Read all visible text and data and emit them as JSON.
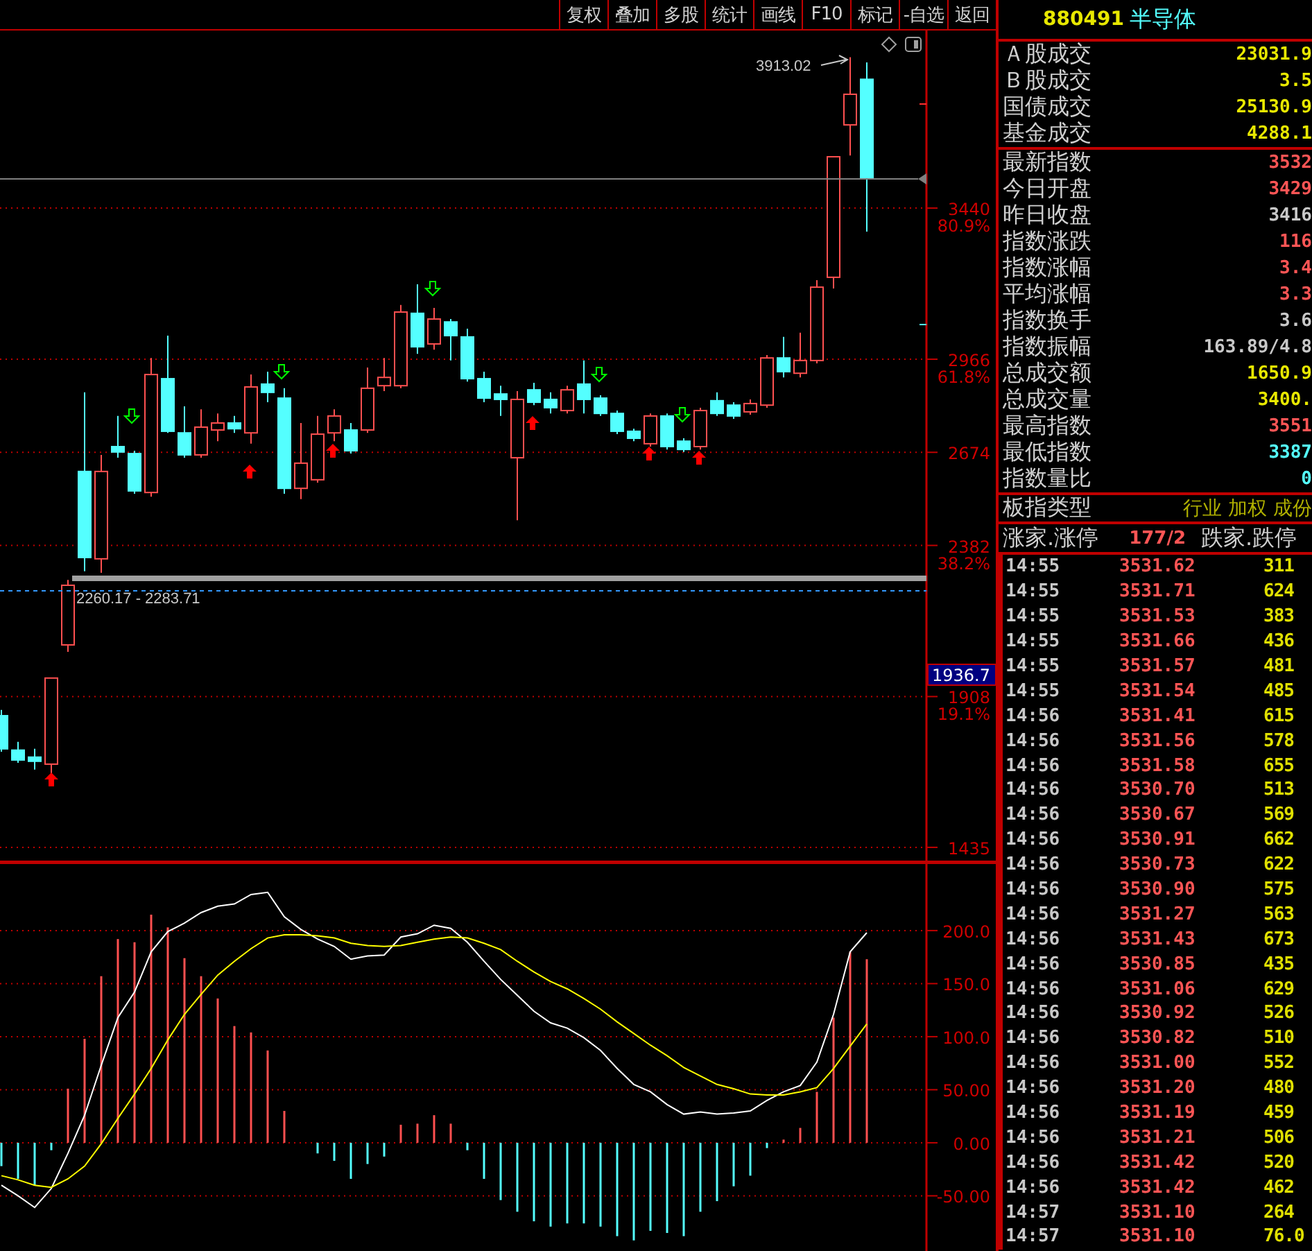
{
  "toolbar": [
    "复权",
    "叠加",
    "多股",
    "统计",
    "画线",
    "F10",
    "标记",
    "-自选",
    "返回"
  ],
  "price_chart": {
    "high_label": "3913.02",
    "zone_label": "2260.17 - 2283.71",
    "cursor_price": "1936.7",
    "percent_labels": [
      "80.9%",
      "61.8%",
      "38.2%",
      "19.1%"
    ],
    "chart_data": {
      "type": "candlestick",
      "ylim": [
        1387,
        3997
      ],
      "grid": true,
      "yticks": [
        {
          "value": 3440,
          "label": "3440"
        },
        {
          "value": 2966,
          "label": "2966"
        },
        {
          "value": 2674,
          "label": "2674"
        },
        {
          "value": 2382,
          "label": "2382"
        },
        {
          "value": 1908,
          "label": "1908"
        },
        {
          "value": 1435,
          "label": "1435"
        }
      ],
      "ohlc": [
        [
          1848,
          1866,
          1735,
          1744
        ],
        [
          1740,
          1766,
          1700,
          1709
        ],
        [
          1718,
          1744,
          1679,
          1705
        ],
        [
          1696,
          1966,
          1666,
          1966
        ],
        [
          2070,
          2274,
          2048,
          2257
        ],
        [
          2614,
          2862,
          2301,
          2344
        ],
        [
          2340,
          2666,
          2296,
          2614
        ],
        [
          2692,
          2788,
          2657,
          2675
        ],
        [
          2670,
          2679,
          2544,
          2553
        ],
        [
          2548,
          2970,
          2535,
          2918
        ],
        [
          2905,
          3040,
          2735,
          2740
        ],
        [
          2735,
          2818,
          2657,
          2666
        ],
        [
          2666,
          2809,
          2657,
          2753
        ],
        [
          2744,
          2796,
          2709,
          2766
        ],
        [
          2766,
          2788,
          2735,
          2748
        ],
        [
          2735,
          2918,
          2701,
          2879
        ],
        [
          2888,
          2927,
          2831,
          2862
        ],
        [
          2844,
          2875,
          2544,
          2561
        ],
        [
          2561,
          2766,
          2527,
          2640
        ],
        [
          2588,
          2788,
          2579,
          2731
        ],
        [
          2735,
          2809,
          2709,
          2788
        ],
        [
          2744,
          2766,
          2670,
          2679
        ],
        [
          2744,
          2940,
          2735,
          2875
        ],
        [
          2883,
          2970,
          2866,
          2909
        ],
        [
          2883,
          3136,
          2875,
          3114
        ],
        [
          3110,
          3201,
          2983,
          3005
        ],
        [
          3014,
          3127,
          2996,
          3092
        ],
        [
          3083,
          3092,
          2962,
          3040
        ],
        [
          3036,
          3062,
          2896,
          2905
        ],
        [
          2905,
          2927,
          2831,
          2844
        ],
        [
          2857,
          2883,
          2788,
          2840
        ],
        [
          2657,
          2866,
          2461,
          2840
        ],
        [
          2870,
          2892,
          2822,
          2831
        ],
        [
          2840,
          2862,
          2796,
          2814
        ],
        [
          2805,
          2883,
          2796,
          2870
        ],
        [
          2888,
          2962,
          2796,
          2840
        ],
        [
          2844,
          2853,
          2788,
          2796
        ],
        [
          2796,
          2805,
          2731,
          2740
        ],
        [
          2740,
          2748,
          2709,
          2718
        ],
        [
          2701,
          2796,
          2692,
          2788
        ],
        [
          2788,
          2796,
          2683,
          2692
        ],
        [
          2709,
          2718,
          2675,
          2683
        ],
        [
          2692,
          2814,
          2683,
          2805
        ],
        [
          2836,
          2862,
          2788,
          2796
        ],
        [
          2822,
          2831,
          2779,
          2788
        ],
        [
          2801,
          2840,
          2792,
          2827
        ],
        [
          2822,
          2979,
          2814,
          2970
        ],
        [
          2970,
          3036,
          2909,
          2927
        ],
        [
          2922,
          3049,
          2909,
          2962
        ],
        [
          2962,
          3214,
          2953,
          3192
        ],
        [
          3223,
          3601,
          3188,
          3601
        ],
        [
          3701,
          3913,
          3605,
          3797
        ],
        [
          3844,
          3897,
          3366,
          3532
        ]
      ]
    }
  },
  "macd": {
    "chart_data": {
      "type": "bar",
      "ylim": [
        -102,
        264
      ],
      "grid": true,
      "yticks": [
        {
          "value": 200,
          "label": "200.0"
        },
        {
          "value": 150,
          "label": "150.0"
        },
        {
          "value": 100,
          "label": "100.0"
        },
        {
          "value": 50,
          "label": "50.00"
        },
        {
          "value": 0,
          "label": "0.00"
        },
        {
          "value": -50,
          "label": "-50.00"
        }
      ],
      "series": [
        {
          "colors": [
            "#54ffff",
            "#54ffff",
            "#54ffff",
            "#54ffff",
            "#ff5050",
            "#ff5050",
            "#ff5050",
            "#ff5050",
            "#ff5050",
            "#ff5050",
            "#ff5050",
            "#ff5050",
            "#ff5050",
            "#ff5050",
            "#ff5050",
            "#ff5050",
            "#ff5050",
            "#ff5050",
            null,
            "#54ffff",
            "#54ffff",
            "#54ffff",
            "#54ffff",
            "#54ffff",
            "#ff5050",
            "#ff5050",
            "#ff5050",
            "#ff5050",
            "#54ffff",
            "#54ffff",
            "#54ffff",
            "#54ffff",
            "#54ffff",
            "#54ffff",
            "#54ffff",
            "#54ffff",
            "#54ffff",
            "#54ffff",
            "#54ffff",
            "#54ffff",
            "#54ffff",
            "#54ffff",
            "#54ffff",
            "#54ffff",
            "#54ffff",
            "#54ffff",
            "#54ffff",
            "#ff5050",
            "#ff5050",
            "#ff5050",
            "#ff5050",
            "#ff5050",
            "#ff5050"
          ],
          "values": [
            -22,
            -34,
            -40,
            -7,
            51,
            98,
            157,
            192,
            189,
            215,
            203,
            174,
            157,
            136,
            110,
            104,
            87,
            30,
            null,
            -10,
            -17,
            -34,
            -20,
            -13,
            17,
            18,
            26,
            18,
            -7,
            -34,
            -54,
            -65,
            -74,
            -79,
            -76,
            -76,
            -79,
            -88,
            -92,
            -83,
            -85,
            -88,
            -65,
            -55,
            -41,
            -31,
            -5,
            3,
            14,
            48,
            118,
            180,
            173
          ]
        },
        {
          "type": "line",
          "color": "#ffffff",
          "values": [
            -40,
            -50,
            -61,
            -43,
            -10,
            26,
            73,
            118,
            142,
            180,
            199,
            207,
            217,
            223,
            225,
            234,
            236,
            213,
            201,
            192,
            185,
            173,
            176,
            177,
            194,
            197,
            205,
            202,
            189,
            171,
            154,
            139,
            124,
            113,
            108,
            99,
            87,
            70,
            55,
            48,
            36,
            27,
            29,
            27,
            28,
            30,
            40,
            48,
            54,
            76,
            121,
            180,
            198
          ]
        },
        {
          "type": "line",
          "color": "#ffff00",
          "values": [
            -31,
            -35,
            -40,
            -42,
            -34,
            -22,
            -1,
            23,
            46,
            70,
            97,
            121,
            140,
            158,
            171,
            183,
            193,
            196,
            196,
            195,
            193,
            188,
            186,
            185,
            186,
            189,
            192,
            194,
            193,
            188,
            182,
            171,
            161,
            152,
            145,
            136,
            126,
            114,
            103,
            92,
            82,
            71,
            63,
            55,
            51,
            46,
            45,
            45,
            48,
            52,
            70,
            91,
            112
          ]
        }
      ]
    }
  },
  "quote": {
    "code": "880491",
    "name": "半导体",
    "market_volume": [
      {
        "label": "Ａ股成交",
        "value": "23031.9",
        "color": "#e8e800"
      },
      {
        "label": "Ｂ股成交",
        "value": "3.5",
        "color": "#e8e800"
      },
      {
        "label": "国债成交",
        "value": "25130.9",
        "color": "#e8e800"
      },
      {
        "label": "基金成交",
        "value": "4288.1",
        "color": "#e8e800"
      }
    ],
    "index_stats": [
      {
        "label": "最新指数",
        "value": "3532",
        "color": "#ff5555"
      },
      {
        "label": "今日开盘",
        "value": "3429",
        "color": "#ff5555"
      },
      {
        "label": "昨日收盘",
        "value": "3416",
        "color": "#c8c8c8"
      },
      {
        "label": "指数涨跌",
        "value": "116",
        "color": "#ff5555"
      },
      {
        "label": "指数涨幅",
        "value": "3.4",
        "color": "#ff5555"
      },
      {
        "label": "平均涨幅",
        "value": "3.3",
        "color": "#ff5555"
      },
      {
        "label": "指数换手",
        "value": "3.6",
        "color": "#c8c8c8"
      },
      {
        "label": "指数振幅",
        "value": "163.89/4.8",
        "color": "#c8c8c8"
      },
      {
        "label": "总成交额",
        "value": "1650.9",
        "color": "#e8e800"
      },
      {
        "label": "总成交量",
        "value": "3400.",
        "color": "#e8e800"
      },
      {
        "label": "最高指数",
        "value": "3551",
        "color": "#ff5555"
      },
      {
        "label": "最低指数",
        "value": "3387",
        "color": "#54ffff"
      },
      {
        "label": "指数量比",
        "value": "0",
        "color": "#54ffff"
      }
    ],
    "index_type": {
      "label": "板指类型",
      "value": "行业 加权 成份"
    },
    "breadth": {
      "label": "涨家.涨停",
      "value": "177/2",
      "label_2": "跌家.跌停"
    },
    "ticks": [
      {
        "time": "14:55",
        "price": "3531.62",
        "volume": "311"
      },
      {
        "time": "14:55",
        "price": "3531.71",
        "volume": "624"
      },
      {
        "time": "14:55",
        "price": "3531.53",
        "volume": "383"
      },
      {
        "time": "14:55",
        "price": "3531.66",
        "volume": "436"
      },
      {
        "time": "14:55",
        "price": "3531.57",
        "volume": "481"
      },
      {
        "time": "14:55",
        "price": "3531.54",
        "volume": "485"
      },
      {
        "time": "14:56",
        "price": "3531.41",
        "volume": "615"
      },
      {
        "time": "14:56",
        "price": "3531.56",
        "volume": "578"
      },
      {
        "time": "14:56",
        "price": "3531.58",
        "volume": "655"
      },
      {
        "time": "14:56",
        "price": "3530.70",
        "volume": "513"
      },
      {
        "time": "14:56",
        "price": "3530.67",
        "volume": "569"
      },
      {
        "time": "14:56",
        "price": "3530.91",
        "volume": "662"
      },
      {
        "time": "14:56",
        "price": "3530.73",
        "volume": "622"
      },
      {
        "time": "14:56",
        "price": "3530.90",
        "volume": "575"
      },
      {
        "time": "14:56",
        "price": "3531.27",
        "volume": "563"
      },
      {
        "time": "14:56",
        "price": "3531.43",
        "volume": "673"
      },
      {
        "time": "14:56",
        "price": "3530.85",
        "volume": "435"
      },
      {
        "time": "14:56",
        "price": "3531.06",
        "volume": "629"
      },
      {
        "time": "14:56",
        "price": "3530.92",
        "volume": "526"
      },
      {
        "time": "14:56",
        "price": "3530.82",
        "volume": "510"
      },
      {
        "time": "14:56",
        "price": "3531.00",
        "volume": "552"
      },
      {
        "time": "14:56",
        "price": "3531.20",
        "volume": "480"
      },
      {
        "time": "14:56",
        "price": "3531.19",
        "volume": "459"
      },
      {
        "time": "14:56",
        "price": "3531.21",
        "volume": "506"
      },
      {
        "time": "14:56",
        "price": "3531.42",
        "volume": "520"
      },
      {
        "time": "14:56",
        "price": "3531.42",
        "volume": "462"
      },
      {
        "time": "14:57",
        "price": "3531.10",
        "volume": "264"
      },
      {
        "time": "14:57",
        "price": "3531.10",
        "volume": "76.0"
      }
    ]
  }
}
